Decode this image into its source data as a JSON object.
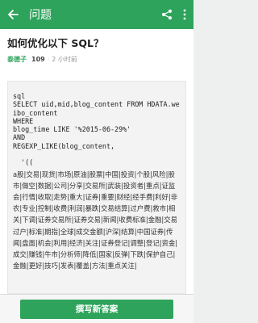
{
  "header": {
    "title": "问题"
  },
  "question": {
    "title": "如何优化以下 SQL？",
    "author": "泰德子",
    "score": "109",
    "separator": "·",
    "time": "2 小时前",
    "code": "sql\nSELECT uid,mid,blog_content FROM HDATA.weibo_content\nWHERE\nblog_time LIKE '%2015-06-29%'\nAND\nREGEXP_LIKE(blog_content,\n\n  '((",
    "tags": "a股|交易|现货|市场|原油|股票|中国|投资|个股|风险|股市|做空|数据|公司|分享|交易所|武装|投资者|重点|证监会|行情|收取|走势|重大|证券|重要|财经|经手费|利好|非农|专业|控制|收费|利润|暴跌|交易结算|过户费|救市|相关|下调|证券交易所|证券交易|新闻|收费标准|金融|交易过户|标准|期指|全球|成交金额|沪深|结算|中国证券|传闻|盘面|机会|利用|经济|关注|证券登记|调整|登记|资金|成交|赚钱|牛市|分析师|降低|国家|反弹|下跌|保护自己|金融|更好|技巧|发表|覆盖|方法|重点关注|"
  },
  "bottom": {
    "answer_label": "撰写新答案"
  }
}
